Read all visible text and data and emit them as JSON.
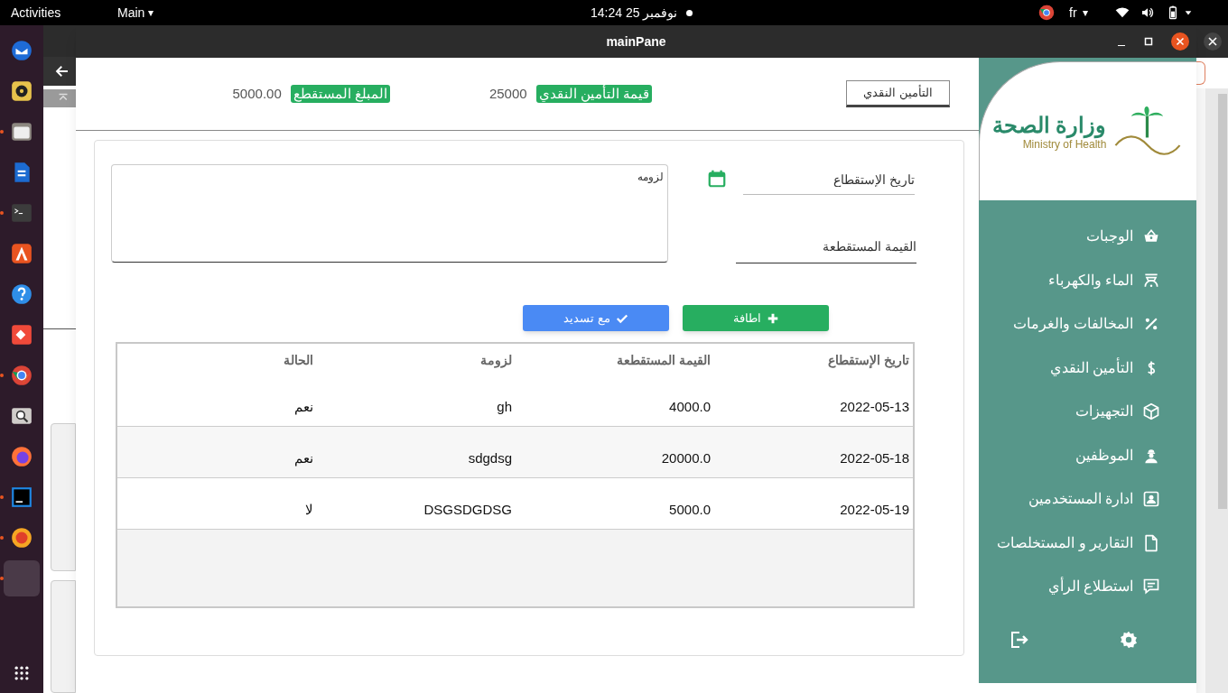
{
  "top_bar": {
    "activities": "Activities",
    "app_menu": "Main",
    "caret": "▾",
    "clock": "14:24 25 نوفمبر",
    "language": "fr",
    "language_caret": "▾"
  },
  "dock": {
    "items": [
      {
        "running": false,
        "selected": false
      },
      {
        "running": false,
        "selected": false
      },
      {
        "running": true,
        "selected": false
      },
      {
        "running": false,
        "selected": false
      },
      {
        "running": true,
        "selected": false
      },
      {
        "running": false,
        "selected": false
      },
      {
        "running": false,
        "selected": false
      },
      {
        "running": false,
        "selected": false
      },
      {
        "running": true,
        "selected": false
      },
      {
        "running": false,
        "selected": false
      },
      {
        "running": false,
        "selected": false
      },
      {
        "running": true,
        "selected": false
      },
      {
        "running": true,
        "selected": false
      },
      {
        "running": true,
        "selected": true
      }
    ]
  },
  "window": {
    "title": "mainPane"
  },
  "header": {
    "button": "التأمين النقدي",
    "stats": [
      {
        "label": "قيمة التأمين النقدي",
        "value": "25000"
      },
      {
        "label": "المبلغ المستقطع",
        "value": "5000.00"
      }
    ]
  },
  "form": {
    "date_field": {
      "placeholder": "تاريخ الإستقطاع"
    },
    "amount_field": {
      "placeholder": "القيمة المستقطعة"
    },
    "notes_field": {
      "placeholder": "لزومه"
    },
    "buttons": [
      {
        "label": "اطافة",
        "kind": "add"
      },
      {
        "label": "مع تسديد",
        "kind": "pay"
      }
    ]
  },
  "table": {
    "columns": [
      "تاريخ الإستقطاع",
      "القيمة المستقطعة",
      "لزومة",
      "الحالة"
    ],
    "rows": [
      [
        "2022-05-13",
        "4000.0",
        "gh",
        "نعم"
      ],
      [
        "2022-05-18",
        "20000.0",
        "sdgdsg",
        "نعم"
      ],
      [
        "2022-05-19",
        "5000.0",
        "DSGSDGDSG",
        "لا"
      ]
    ]
  },
  "sidebar": {
    "logo": {
      "arabic": "وزارة الصحة",
      "english": "Ministry of Health"
    },
    "items": [
      {
        "label": "الوجبات",
        "selected": false
      },
      {
        "label": "الماء والكهرباء",
        "selected": false
      },
      {
        "label": "المخالفات والغرمات",
        "selected": false
      },
      {
        "label": "التأمين النقدي",
        "selected": false
      },
      {
        "label": "التجهيزات",
        "selected": false
      },
      {
        "label": "الموظفين",
        "selected": false
      },
      {
        "label": "ادارة المستخدمين",
        "selected": false
      },
      {
        "label": "التقارير و المستخلصات",
        "selected": false
      },
      {
        "label": "استطلاع الرأي",
        "selected": false
      }
    ]
  }
}
